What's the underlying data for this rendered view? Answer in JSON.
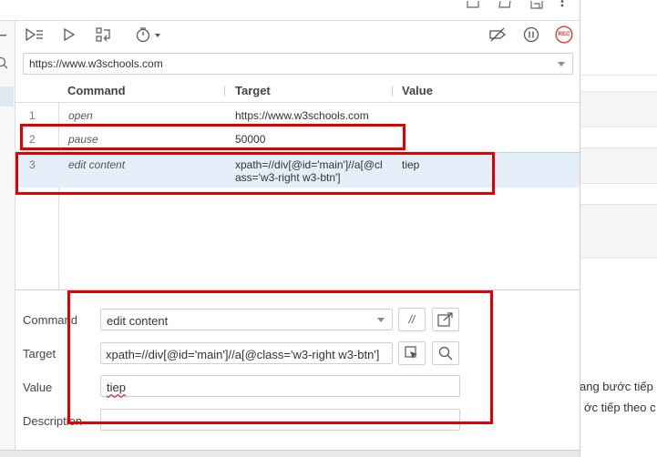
{
  "toolbar": {
    "run_all_icon": "run-all-tests-icon",
    "run_icon": "run-current-test-icon",
    "step_icon": "step-over-icon",
    "speed_icon": "speed-timer-icon",
    "disable_breakpoints_icon": "disable-breakpoints-icon",
    "pause_icon": "pause-on-exceptions-icon",
    "record_label": "REC",
    "record_color": "#e53935"
  },
  "url_bar": {
    "value": "https://www.w3schools.com"
  },
  "table": {
    "headers": {
      "command": "Command",
      "target": "Target",
      "value": "Value"
    },
    "rows": [
      {
        "num": "1",
        "command": "open",
        "target": "https://www.w3schools.com",
        "value": ""
      },
      {
        "num": "2",
        "command": "pause",
        "target": "50000",
        "value": ""
      },
      {
        "num": "3",
        "command": "edit content",
        "target_line1": "xpath=//div[@id='main']//a[@cl",
        "target_line2": "ass='w3-right w3-btn']",
        "value": "tiep"
      }
    ]
  },
  "editor": {
    "command_label": "Command",
    "command_value": "edit content",
    "comment_button": "//",
    "target_label": "Target",
    "target_value": "xpath=//div[@id='main']//a[@class='w3-right w3-btn']",
    "value_label": "Value",
    "value_value": "tiep",
    "description_label": "Description",
    "description_value": ""
  },
  "background_page": {
    "line1": "ang bước tiếp",
    "line2": "ớc tiếp theo c"
  },
  "colors": {
    "highlight": "#e00000",
    "selected_row": "#e3eef8",
    "record": "#e53935"
  }
}
